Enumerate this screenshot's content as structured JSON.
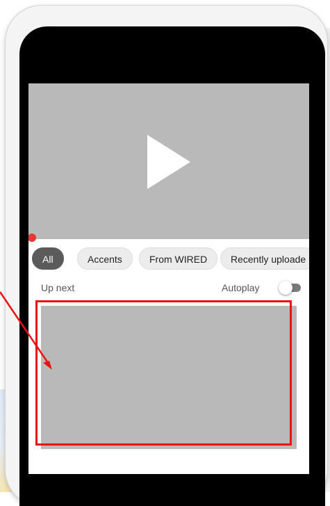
{
  "player": {
    "play_icon": "play-icon"
  },
  "chips": [
    {
      "label": "All",
      "active": true
    },
    {
      "label": "Accents",
      "active": false
    },
    {
      "label": "From WIRED",
      "active": false
    },
    {
      "label": "Recently uploade",
      "active": false
    }
  ],
  "up_next": {
    "label": "Up next",
    "autoplay_label": "Autoplay",
    "autoplay_on": false
  },
  "colors": {
    "highlight": "#ee1111",
    "progress": "#e53935",
    "placeholder": "#b9b9b9"
  }
}
